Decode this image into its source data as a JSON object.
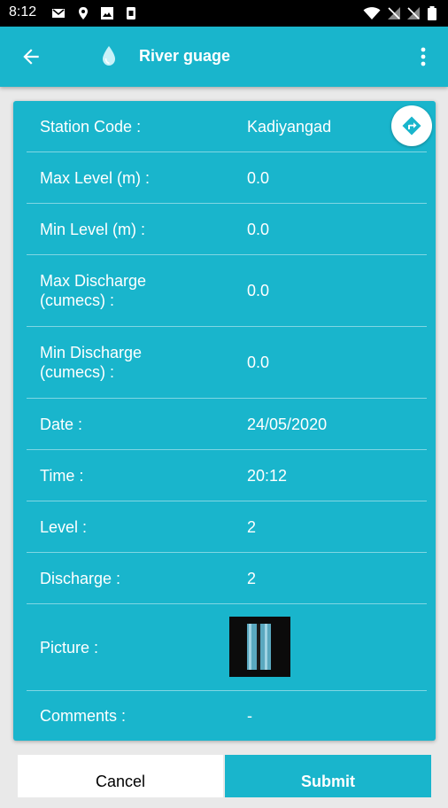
{
  "status_bar": {
    "time": "8:12",
    "left_icons": [
      "gmail-icon",
      "location-icon",
      "image-icon",
      "sim-icon"
    ],
    "right_icons": [
      "wifi-icon",
      "no-signal-icon",
      "no-signal-icon",
      "battery-icon"
    ]
  },
  "app_bar": {
    "title": "River guage",
    "accent_color": "#19b5cc"
  },
  "form": {
    "rows": [
      {
        "label": "Station Code :",
        "value": "Kadiyangad"
      },
      {
        "label": "Max Level (m) :",
        "value": "0.0"
      },
      {
        "label": "Min Level (m) :",
        "value": "0.0"
      },
      {
        "label": "Max Discharge\n(cumecs)  :",
        "value": "0.0"
      },
      {
        "label": "Min Discharge\n(cumecs)  :",
        "value": "0.0"
      },
      {
        "label": "Date :",
        "value": "24/05/2020"
      },
      {
        "label": "Time :",
        "value": "20:12"
      },
      {
        "label": "Level :",
        "value": "2"
      },
      {
        "label": "Discharge :",
        "value": "2"
      },
      {
        "label": "Picture :",
        "value": ""
      },
      {
        "label": "Comments :",
        "value": "-"
      }
    ]
  },
  "actions": {
    "cancel_label": "Cancel",
    "submit_label": "Submit"
  }
}
